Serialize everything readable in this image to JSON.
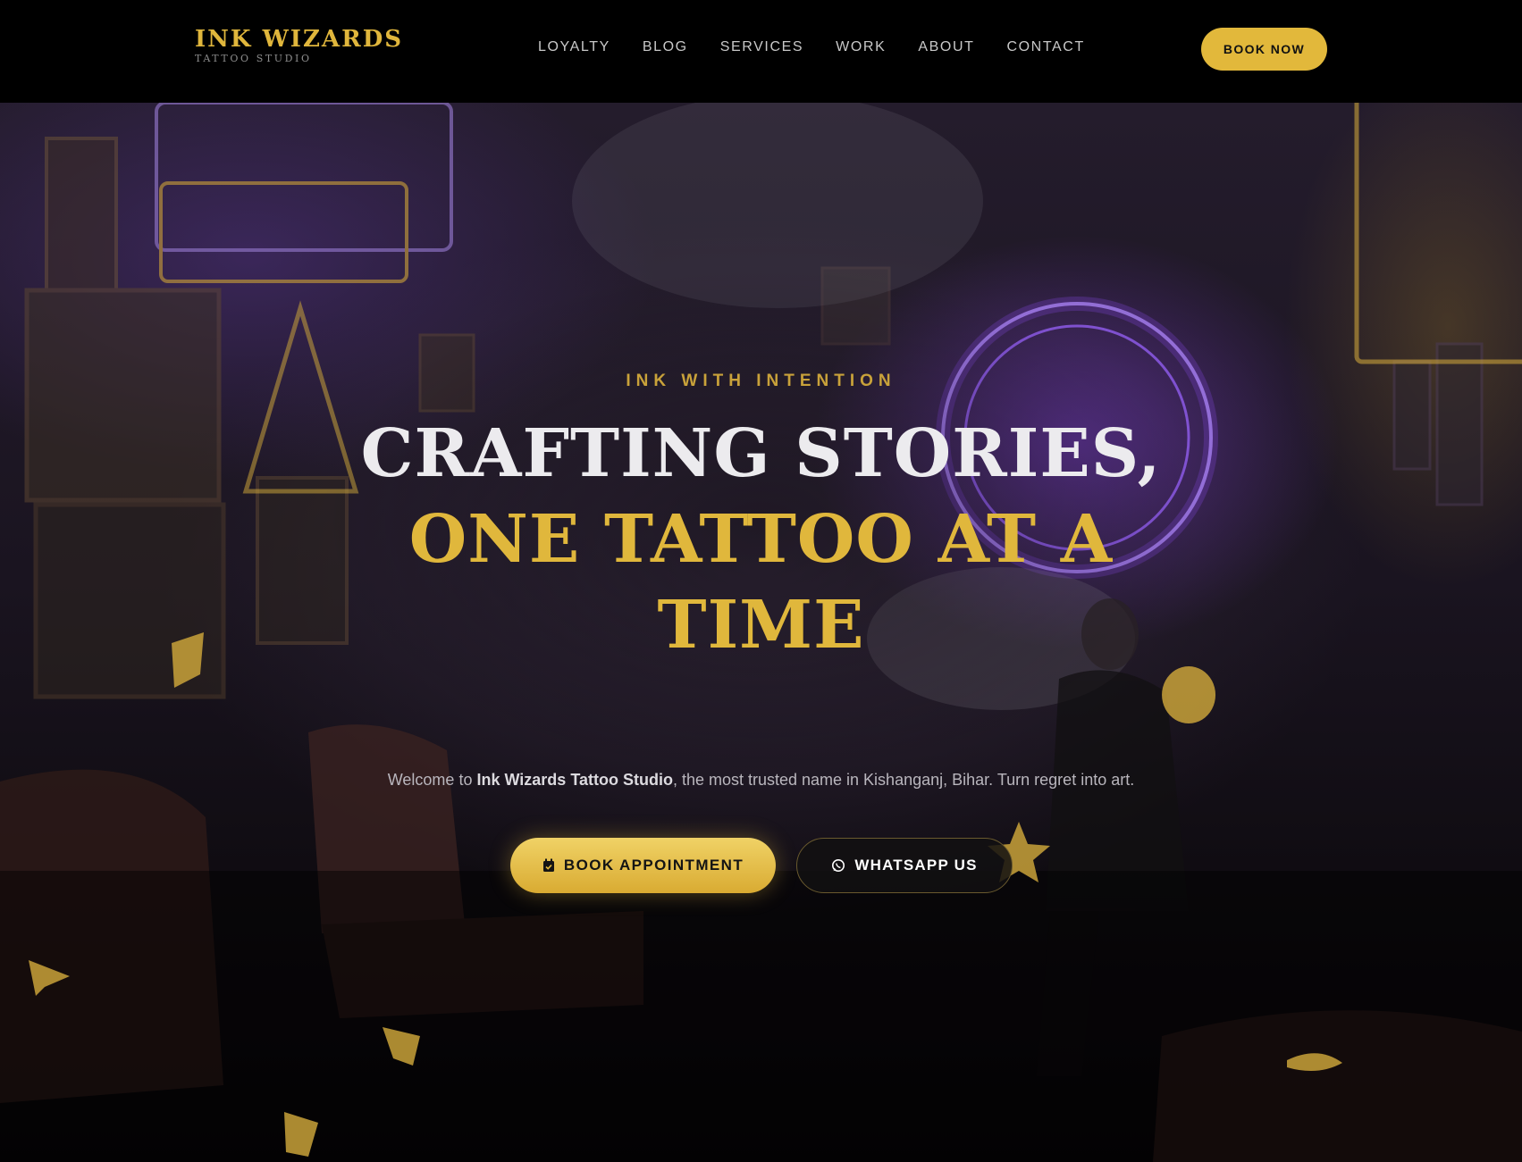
{
  "brand": {
    "name": "INK WIZARDS",
    "subtitle": "TATTOO STUDIO"
  },
  "nav": {
    "items": [
      {
        "label": "LOYALTY"
      },
      {
        "label": "BLOG"
      },
      {
        "label": "SERVICES"
      },
      {
        "label": "WORK"
      },
      {
        "label": "ABOUT"
      },
      {
        "label": "CONTACT"
      }
    ],
    "book_now_label": "BOOK NOW"
  },
  "hero": {
    "eyebrow": "INK WITH INTENTION",
    "headline_line1": "CRAFTING STORIES,",
    "headline_line2": "ONE TATTOO AT A",
    "headline_line3": "TIME",
    "lede_prefix": "Welcome to ",
    "lede_bold": "Ink Wizards Tattoo Studio",
    "lede_suffix": ", the most trusted name in Kishanganj, Bihar. Turn regret into art.",
    "primary_cta": {
      "label": "BOOK APPOINTMENT",
      "icon": "calendar-icon"
    },
    "secondary_cta": {
      "label": "WHATSAPP US",
      "icon": "whatsapp-icon"
    }
  },
  "colors": {
    "accent_gold": "#e0b73c",
    "nav_background": "#000000",
    "neon_purple": "#8a4fe0"
  }
}
